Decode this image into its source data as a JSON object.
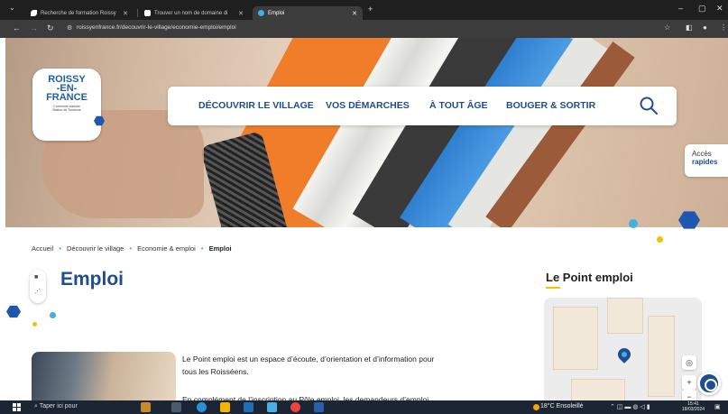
{
  "browser": {
    "tabs": [
      {
        "label": "Recherche de formation Roissy",
        "active": false
      },
      {
        "label": "Trouver un nom de domaine di",
        "active": false
      },
      {
        "label": "Emploi",
        "active": true
      }
    ],
    "new_tab": "+",
    "url": "roissyenfrance.fr/decouvrir-le-village/economie-emploi/emploi"
  },
  "site": {
    "logo": {
      "name": "ROISSY\n-EN-\nFRANCE",
      "tagline": "Commune classée\nStation de Tourisme"
    },
    "menu": [
      "DÉCOUVRIR LE VILLAGE",
      "VOS DÉMARCHES",
      "À TOUT ÂGE",
      "BOUGER & SORTIR"
    ],
    "quick_access": {
      "line1": "Accès",
      "line2": "rapides"
    }
  },
  "breadcrumb": [
    "Accueil",
    "Découvrir le village",
    "Economie & emploi",
    "Emploi"
  ],
  "page": {
    "title": "Emploi",
    "intro_line1": "Le Point emploi est un espace d’écoute, d’orientation et d’information pour",
    "intro_line2": "tous les Roisséens.",
    "next_para": "En complément de l’inscription au Pôle emploi, les demandeurs d’emploi"
  },
  "sidebar": {
    "title": "Le Point emploi"
  },
  "map": {
    "zoom_in": "+",
    "zoom_out": "−",
    "locate": "◎"
  },
  "taskbar": {
    "search_placeholder": "Taper ici pour",
    "weather": "18°C Ensoleillé",
    "time": "15:41",
    "date": "18/03/2024"
  },
  "colors": {
    "brand_blue": "#1e4d92",
    "accent_cyan": "#3fb0e0",
    "accent_yellow": "#f2c300"
  }
}
